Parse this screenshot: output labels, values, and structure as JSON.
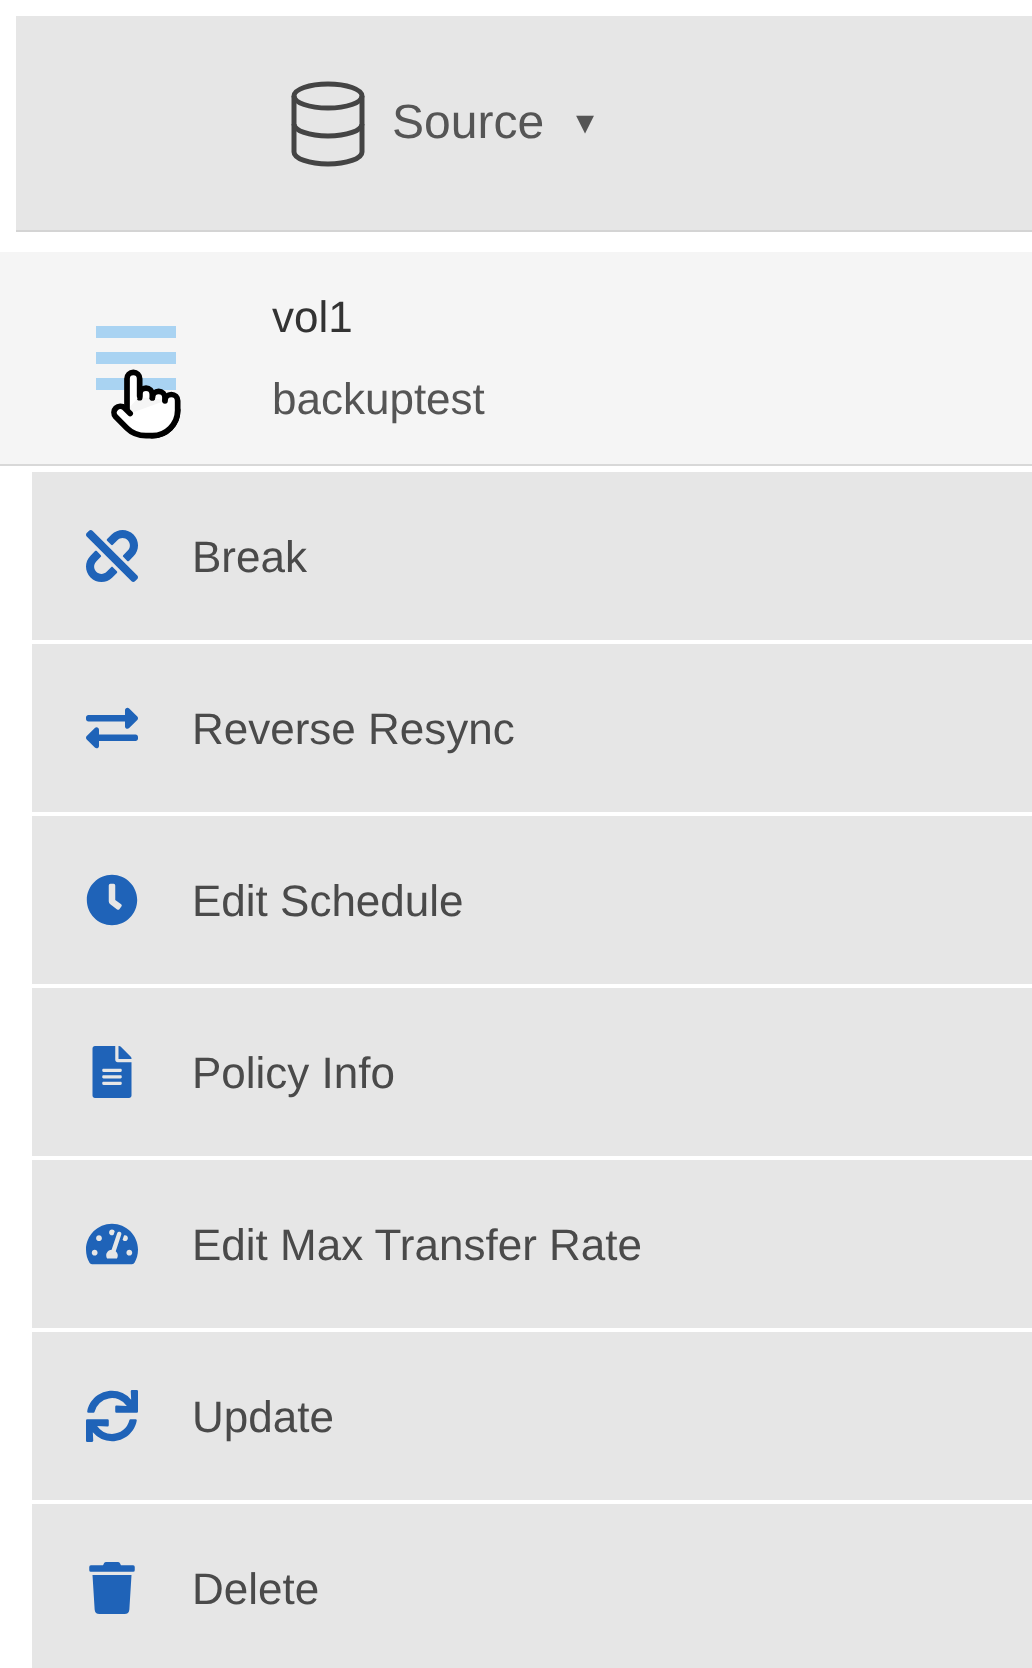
{
  "header": {
    "label": "Source",
    "caret": "▾"
  },
  "volume": {
    "name": "vol1",
    "subtitle": "backuptest"
  },
  "menu": [
    {
      "kind": "break",
      "label": "Break"
    },
    {
      "kind": "reverse",
      "label": "Reverse Resync"
    },
    {
      "kind": "schedule",
      "label": "Edit Schedule"
    },
    {
      "kind": "policy",
      "label": "Policy Info"
    },
    {
      "kind": "rate",
      "label": "Edit Max Transfer Rate"
    },
    {
      "kind": "update",
      "label": "Update"
    },
    {
      "kind": "delete",
      "label": "Delete"
    }
  ]
}
